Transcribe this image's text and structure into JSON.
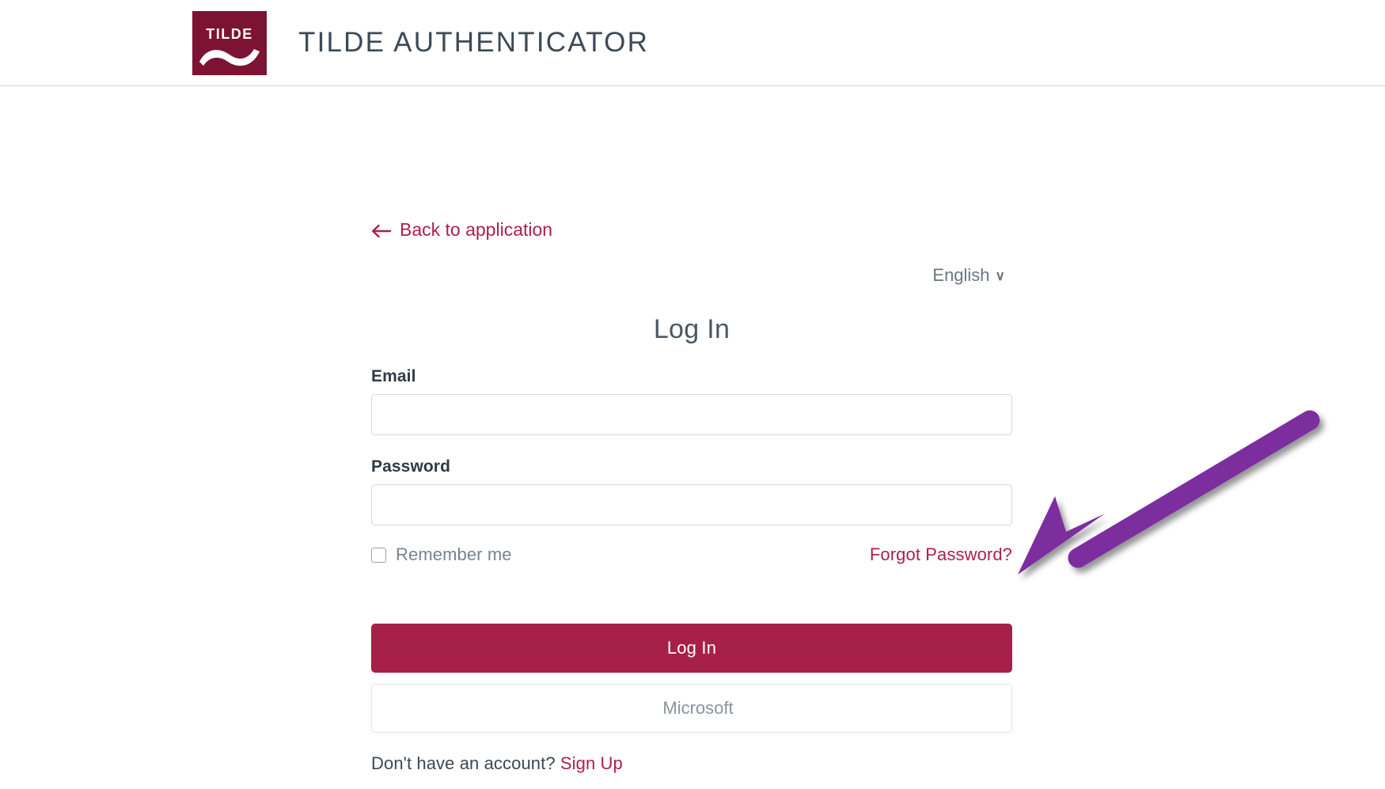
{
  "header": {
    "logo_text": "TILDE",
    "logo_icon": "tilde-swoosh-icon",
    "title": "TILDE AUTHENTICATOR"
  },
  "back_link": {
    "label": "Back to application",
    "icon": "arrow-left-icon"
  },
  "language": {
    "selected": "English",
    "chevron": "∨"
  },
  "form": {
    "heading": "Log In",
    "email": {
      "label": "Email",
      "value": "",
      "placeholder": ""
    },
    "password": {
      "label": "Password",
      "value": "",
      "placeholder": ""
    },
    "remember_me": {
      "label": "Remember me",
      "checked": false
    },
    "forgot_password": "Forgot Password?",
    "submit_label": "Log In",
    "identity_provider": "Microsoft",
    "signup_prompt": "Don't have an account?",
    "signup_link": "Sign Up"
  },
  "annotation": {
    "type": "arrow",
    "color": "#7b2d9e",
    "points_to": "Forgot Password?"
  },
  "colors": {
    "brand_maroon": "#7d1334",
    "accent_crimson": "#a6204a",
    "link_crimson": "#ad1f4c",
    "title_slate": "#3d4a57",
    "muted_gray": "#7a838d",
    "border_gray": "#d4d8dd",
    "annotation_purple": "#7b2d9e"
  }
}
